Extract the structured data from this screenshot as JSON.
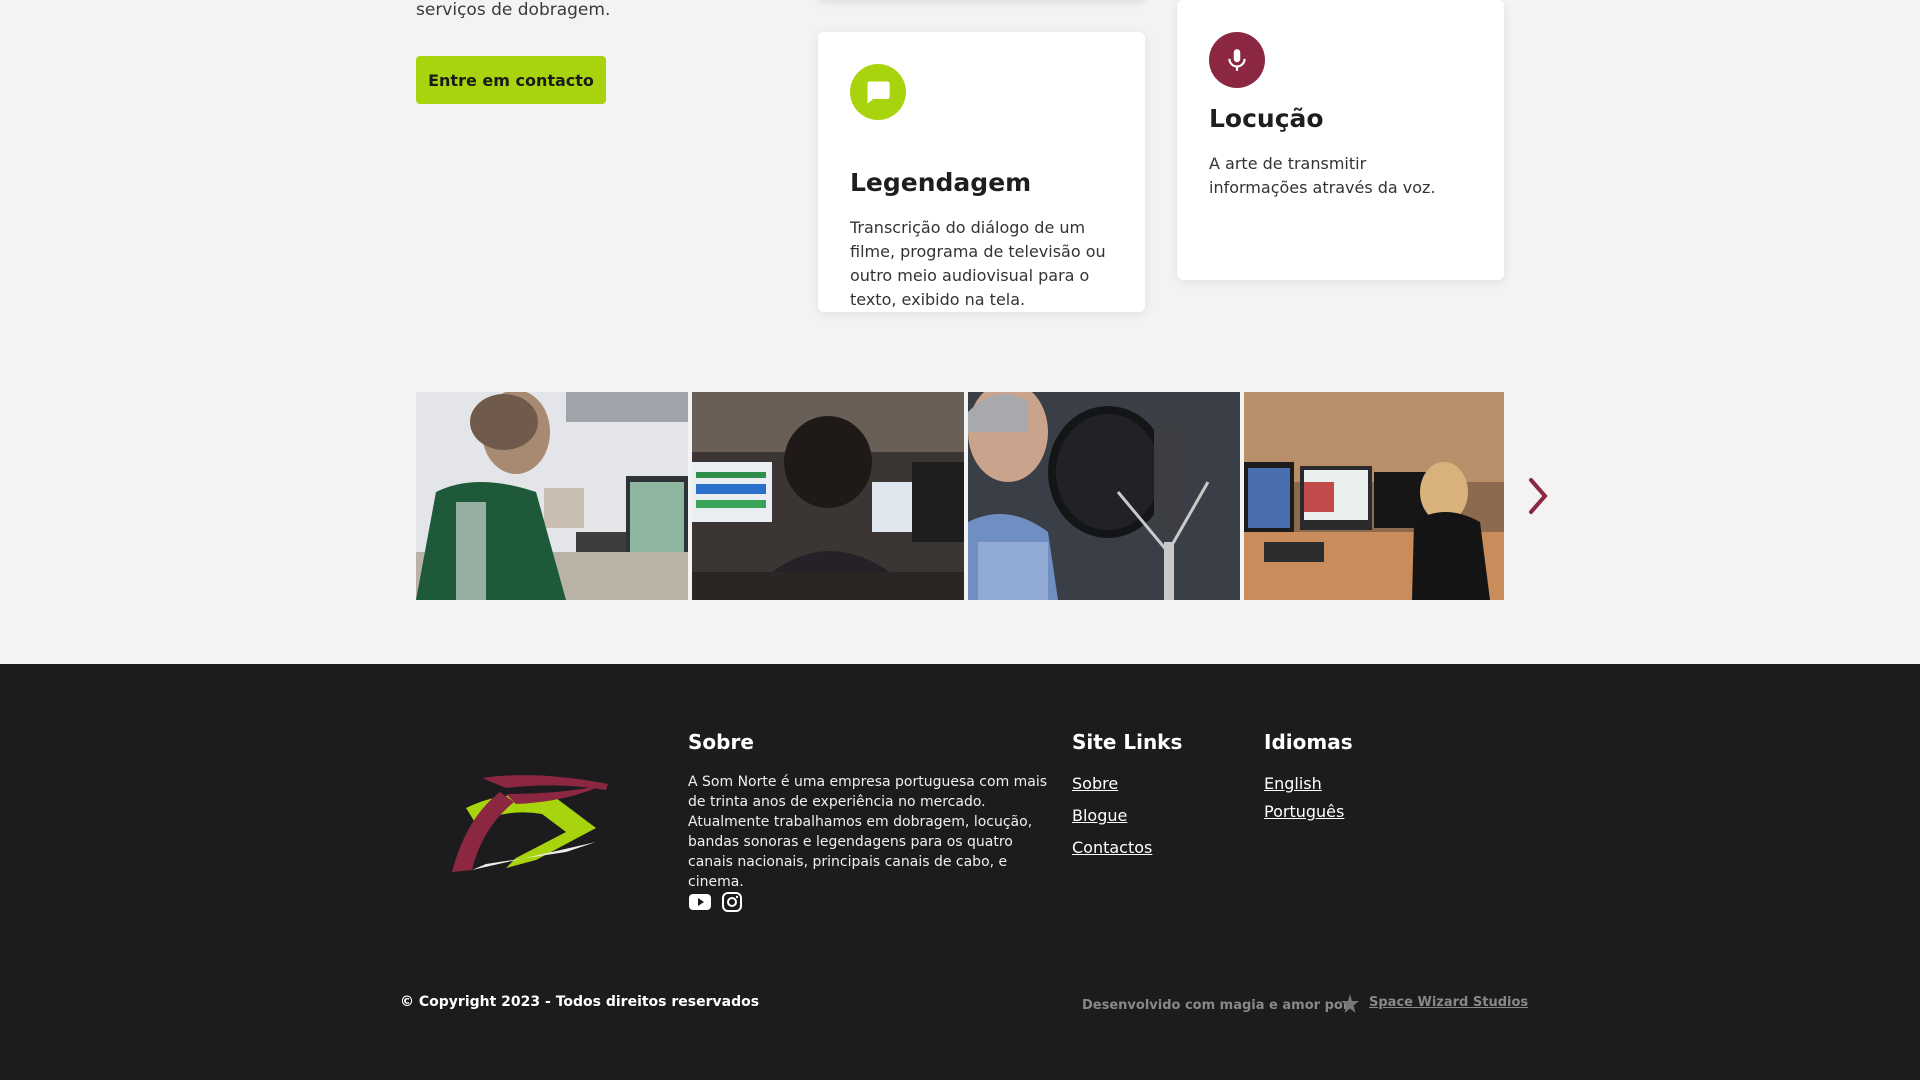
{
  "intro": {
    "text_tail": "serviços de dobragem.",
    "cta_label": "Entre em contacto"
  },
  "services": [
    {
      "title": "Legendagem",
      "description": "Transcrição do diálogo de um filme, programa de televisão ou outro meio audiovisual para o texto, exibido na tela.",
      "icon": "chat-bubble-icon",
      "color": "#a8d40e"
    },
    {
      "title": "Locução",
      "description": "A arte de transmitir informações através da voz.",
      "icon": "microphone-icon",
      "color": "#8b2740"
    }
  ],
  "gallery": {
    "photos": [
      "editor-at-audio-workstation",
      "engineer-at-mixing-desk",
      "singer-at-microphone",
      "woman-at-studio-desk"
    ],
    "next_icon": "chevron-right-icon"
  },
  "footer": {
    "sobre": {
      "title": "Sobre",
      "text": "A Som Norte é uma empresa portuguesa com mais de trinta anos de experiência no mercado. Atualmente trabalhamos em dobragem, locução, bandas sonoras e legendagens para os quatro canais nacionais, principais canais de cabo, e cinema."
    },
    "site_links": {
      "title": "Site Links",
      "items": [
        "Sobre",
        "Blogue",
        "Contactos"
      ]
    },
    "idiomas": {
      "title": "Idiomas",
      "items": [
        "English",
        "Português"
      ]
    },
    "social": [
      "youtube-icon",
      "instagram-icon"
    ],
    "copyright": "© Copyright 2023 - Todos direitos reservados",
    "dev_text": "Desenvolvido com magia e amor por",
    "dev_link": "Space Wizard Studios"
  },
  "colors": {
    "accent_green": "#a8d40e",
    "accent_wine": "#8b2740",
    "footer_bg": "#1c1c1e",
    "page_bg": "#f3f3f4"
  }
}
